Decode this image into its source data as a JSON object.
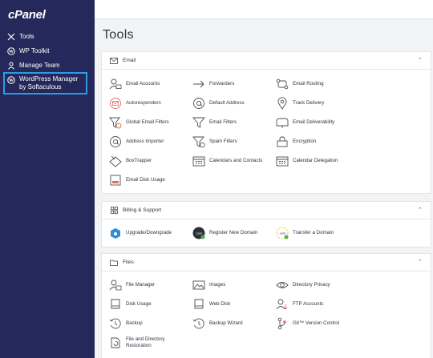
{
  "sidebar": {
    "logo": "cPanel",
    "items": [
      {
        "label": "Tools"
      },
      {
        "label": "WP Toolkit"
      },
      {
        "label": "Manage Team"
      },
      {
        "label": "WordPress Manager by Softaculous"
      }
    ]
  },
  "main": {
    "title": "Tools",
    "sections": [
      {
        "title": "Email",
        "items": [
          "Email Accounts",
          "Forwarders",
          "Email Routing",
          "Autoresponders",
          "Default Address",
          "Track Delivery",
          "Global Email Filters",
          "Email Filters",
          "Email Deliverability",
          "Address Importer",
          "Spam Filters",
          "Encryption",
          "BoxTrapper",
          "Calendars and Contacts",
          "Calendar Delegation",
          "Email Disk Usage"
        ]
      },
      {
        "title": "Billing & Support",
        "items": [
          "Upgrade/Downgrade",
          "Register New Domain",
          "Transfer a Domain"
        ]
      },
      {
        "title": "Files",
        "items": [
          "File Manager",
          "Images",
          "Directory Privacy",
          "Disk Usage",
          "Web Disk",
          "FTP Accounts",
          "Backup",
          "Backup Wizard",
          "Git™ Version Control",
          "File and Directory Restoration"
        ]
      }
    ]
  },
  "colors": {
    "sidebar": "#24285a",
    "accent": "#2e9be6",
    "icon": "#4a4f57"
  }
}
